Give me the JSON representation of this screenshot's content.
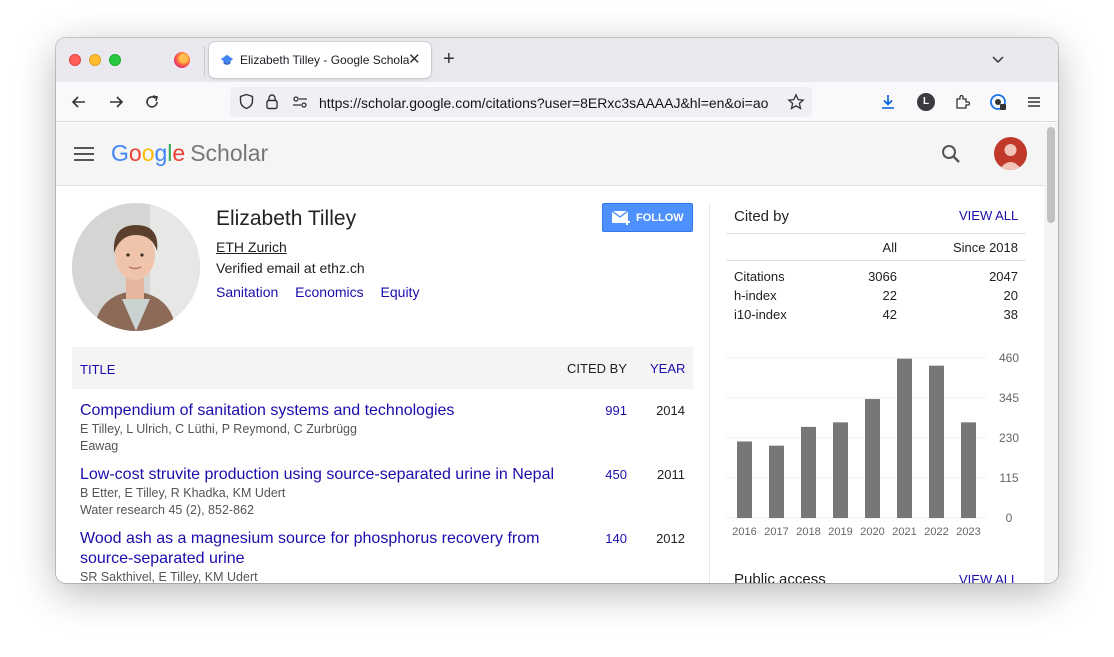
{
  "browser": {
    "tab_title": "Elizabeth Tilley - Google Scholar",
    "url": "https://scholar.google.com/citations?user=8ERxc3sAAAAJ&hl=en&oi=ao",
    "profile_initial": "L"
  },
  "header": {
    "logo_letters": [
      "G",
      "o",
      "o",
      "g",
      "l",
      "e"
    ],
    "logo_product": "Scholar"
  },
  "profile": {
    "name": "Elizabeth Tilley",
    "affiliation": "ETH Zurich",
    "email": "Verified email at ethz.ch",
    "interests": [
      "Sanitation",
      "Economics",
      "Equity"
    ],
    "follow_label": "FOLLOW"
  },
  "table": {
    "col_title": "TITLE",
    "col_cited": "CITED BY",
    "col_year": "YEAR",
    "rows": [
      {
        "title": "Compendium of sanitation systems and technologies",
        "authors": "E Tilley, L Ulrich, C Lüthi, P Reymond, C Zurbrügg",
        "venue": "Eawag",
        "cited": "991",
        "year": "2014"
      },
      {
        "title": "Low-cost struvite production using source-separated urine in Nepal",
        "authors": "B Etter, E Tilley, R Khadka, KM Udert",
        "venue": "Water research 45 (2), 852-862",
        "cited": "450",
        "year": "2011"
      },
      {
        "title": "Wood ash as a magnesium source for phosphorus recovery from source-separated urine",
        "authors": "SR Sakthivel, E Tilley, KM Udert",
        "venue": "",
        "cited": "140",
        "year": "2012"
      }
    ]
  },
  "cited_by": {
    "title": "Cited by",
    "view_all": "VIEW ALL",
    "col_all": "All",
    "col_since": "Since 2018",
    "metrics": [
      {
        "label": "Citations",
        "all": "3066",
        "since": "2047"
      },
      {
        "label": "h-index",
        "all": "22",
        "since": "20"
      },
      {
        "label": "i10-index",
        "all": "42",
        "since": "38"
      }
    ]
  },
  "chart_data": {
    "type": "bar",
    "categories": [
      "2016",
      "2017",
      "2018",
      "2019",
      "2020",
      "2021",
      "2022",
      "2023"
    ],
    "values": [
      220,
      208,
      262,
      275,
      342,
      458,
      438,
      275
    ],
    "yticks": [
      0,
      115,
      230,
      345,
      460
    ],
    "ylim": [
      0,
      460
    ],
    "bar_color": "#777777"
  },
  "public_access": {
    "title": "Public access",
    "view_all": "VIEW ALL"
  },
  "colors": {
    "link": "#1a0dab",
    "follow": "#4d90fe"
  }
}
